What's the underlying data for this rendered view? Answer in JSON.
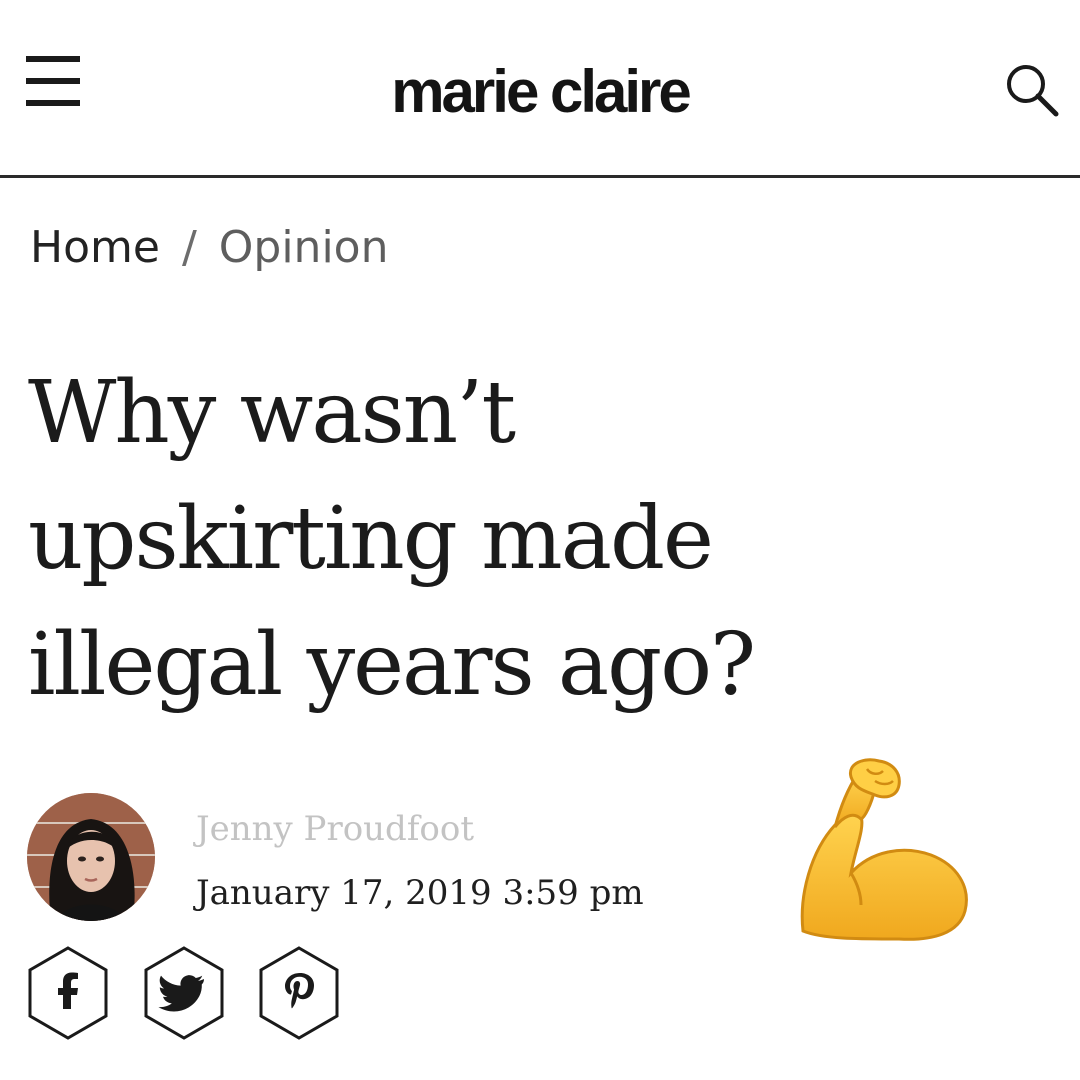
{
  "header": {
    "logo": "marie claire",
    "menu_icon": "hamburger-menu-icon",
    "search_icon": "search-icon"
  },
  "breadcrumb": {
    "home": "Home",
    "separator": "/",
    "section": "Opinion"
  },
  "article": {
    "headline_lines": [
      "Why wasn’t",
      "upskirting made",
      "illegal years ago?"
    ],
    "author": "Jenny Proudfoot",
    "date": "January 17, 2019 3:59 pm"
  },
  "share": {
    "items": [
      {
        "icon": "facebook-icon"
      },
      {
        "icon": "twitter-icon"
      },
      {
        "icon": "pinterest-icon"
      }
    ]
  },
  "decoration": {
    "emoji": "flexed-biceps-emoji",
    "emoji_color": "#f5c02e"
  },
  "colors": {
    "text": "#1b1b1b",
    "muted": "#c3c3c3",
    "divider": "#2a2a2a"
  }
}
